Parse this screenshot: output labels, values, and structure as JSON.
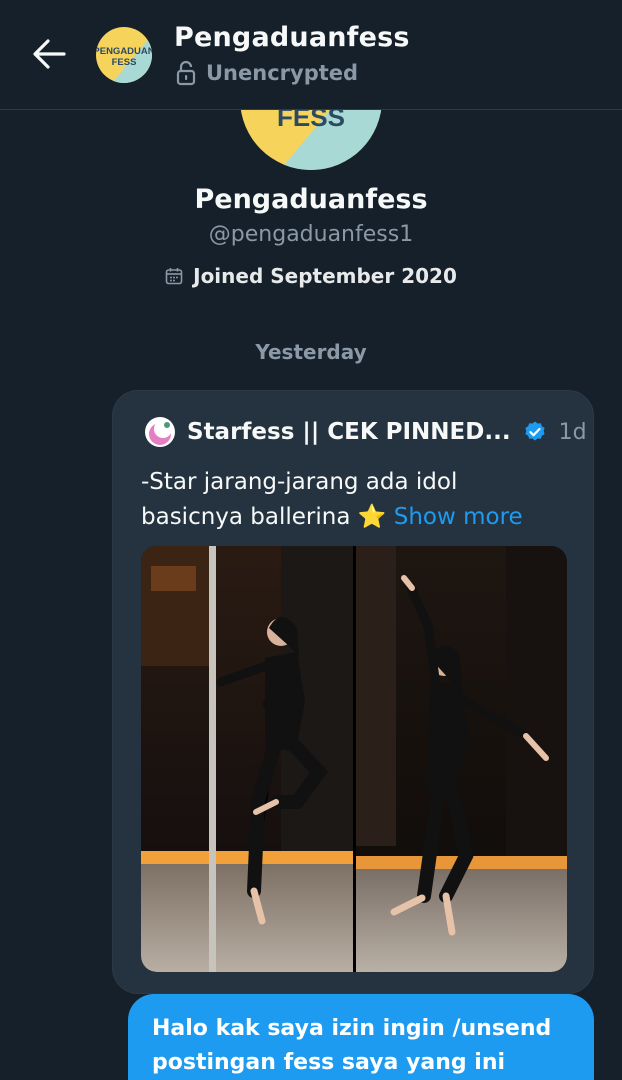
{
  "header": {
    "title": "Pengaduanfess",
    "status": "Unencrypted",
    "avatar_text": [
      "PENGADUAN",
      "FESS"
    ]
  },
  "profile": {
    "avatar_text": "FESS",
    "name": "Pengaduanfess",
    "handle": "@pengaduanfess1",
    "joined": "Joined September 2020"
  },
  "date_separator": "Yesterday",
  "shared_post": {
    "author": "Starfess || CEK PINNED...",
    "time": "1d",
    "text_line1": "-Star jarang-jarang ada idol",
    "text_line2": "basicnya ballerina",
    "emoji": "⭐",
    "show_more": "Show more",
    "image_count": 2
  },
  "message": {
    "text": "Halo kak saya izin ingin /unsend postingan fess saya yang ini"
  },
  "colors": {
    "background": "#15202b",
    "card": "#253341",
    "accent": "#1d9bf0",
    "muted": "#8b98a5",
    "logo_yellow": "#f6d35b",
    "logo_teal": "#a9d9d4"
  }
}
